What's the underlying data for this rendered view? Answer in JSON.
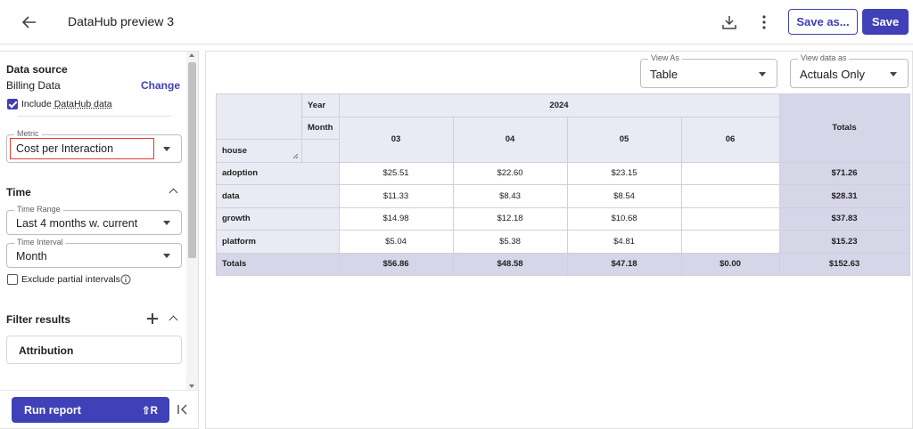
{
  "header": {
    "title": "DataHub preview 3",
    "save_as_label": "Save as...",
    "save_label": "Save"
  },
  "data_source": {
    "title": "Data source",
    "name": "Billing Data",
    "change_label": "Change",
    "include_label": "Include",
    "include_link": "DataHub data",
    "include_checked": true
  },
  "metric": {
    "label": "Metric",
    "value": "Cost per Interaction"
  },
  "time": {
    "title": "Time",
    "range_label": "Time Range",
    "range_value": "Last 4 months w. current",
    "interval_label": "Time Interval",
    "interval_value": "Month",
    "exclude_label": "Exclude partial intervals",
    "exclude_checked": false
  },
  "filter": {
    "title": "Filter results",
    "items": [
      "Attribution"
    ]
  },
  "run": {
    "label": "Run report",
    "shortcut": "⇧R"
  },
  "view": {
    "view_as_label": "View As",
    "view_as_value": "Table",
    "view_data_label": "View data as",
    "view_data_value": "Actuals Only"
  },
  "table": {
    "year_label": "Year",
    "month_label": "Month",
    "row_dim": "house",
    "year": "2024",
    "months": [
      "03",
      "04",
      "05",
      "06"
    ],
    "totals_label": "Totals",
    "rows": [
      {
        "name": "adoption",
        "values": [
          "$25.51",
          "$22.60",
          "$23.15",
          ""
        ],
        "total": "$71.26"
      },
      {
        "name": "data",
        "values": [
          "$11.33",
          "$8.43",
          "$8.54",
          ""
        ],
        "total": "$28.31"
      },
      {
        "name": "growth",
        "values": [
          "$14.98",
          "$12.18",
          "$10.68",
          ""
        ],
        "total": "$37.83"
      },
      {
        "name": "platform",
        "values": [
          "$5.04",
          "$5.38",
          "$4.81",
          ""
        ],
        "total": "$15.23"
      }
    ],
    "totals_row": {
      "name": "Totals",
      "values": [
        "$56.86",
        "$48.58",
        "$47.18",
        "$0.00"
      ],
      "total": "$152.63"
    }
  },
  "colors": {
    "accent": "#4040b8",
    "header_bg": "#eaeaf4",
    "totals_bg": "#d6d6e8",
    "highlight": "#e53935"
  }
}
